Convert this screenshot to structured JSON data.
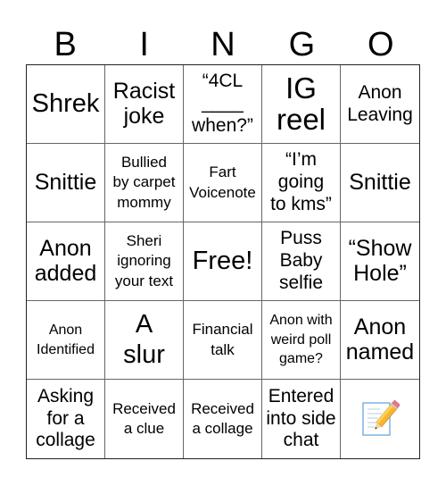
{
  "header": {
    "letters": [
      "B",
      "I",
      "N",
      "G",
      "O"
    ]
  },
  "card": {
    "rows": [
      [
        "Shrek",
        "Racist\njoke",
        "“4CL\n____\nwhen?”",
        "IG\nreel",
        "Anon\nLeaving"
      ],
      [
        "Snittie",
        "Bullied\nby carpet\nmommy",
        "Fart\nVoicenote",
        "“I’m\ngoing\nto kms”",
        "Snittie"
      ],
      [
        "Anon\nadded",
        "Sheri\nignoring\nyour text",
        "Free!",
        "Puss\nBaby\nselfie",
        "“Show\nHole”"
      ],
      [
        "Anon\nIdentified",
        "A\nslur",
        "Financial\ntalk",
        "Anon with\nweird poll\ngame?",
        "Anon\nnamed"
      ],
      [
        "Asking\nfor a\ncollage",
        "Received\na clue",
        "Received\na collage",
        "Entered\ninto side\nchat",
        ""
      ]
    ],
    "free_space": "Free!",
    "bottom_right_icon": "memo-pencil-icon"
  }
}
